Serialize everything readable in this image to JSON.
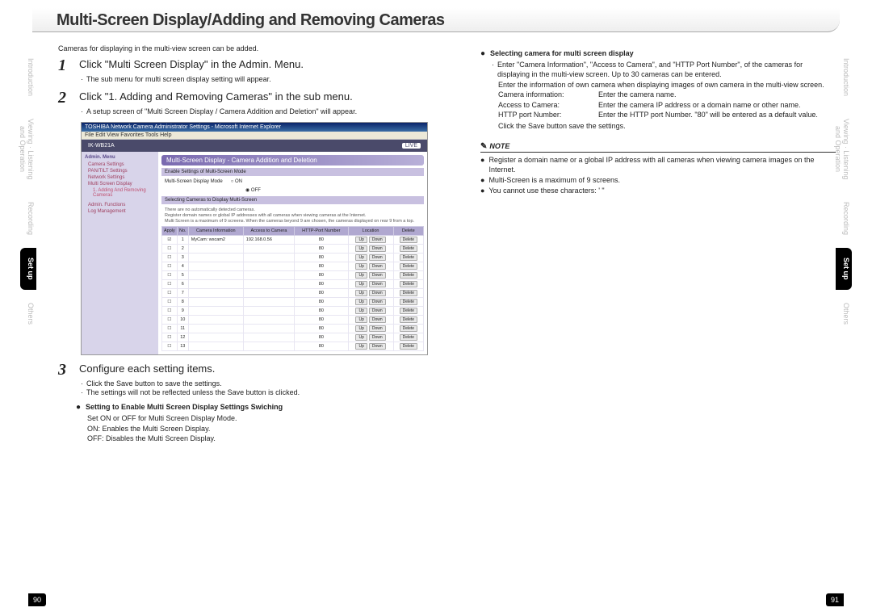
{
  "title": "Multi-Screen Display/Adding and Removing Cameras",
  "side_tabs": [
    "Introduction",
    "Viewing · Listening\nand Operation",
    "Recording",
    "Set up",
    "Others"
  ],
  "intro": "Cameras for displaying in the multi-view screen can be added.",
  "steps": {
    "s1": {
      "num": "1",
      "title": "Click \"Multi Screen Display\" in the Admin. Menu.",
      "b1": "The sub menu for multi screen display setting will appear."
    },
    "s2": {
      "num": "2",
      "title": "Click \"1. Adding and Removing Cameras\" in the sub menu.",
      "b1": "A setup screen of \"Multi Screen Display / Camera Addition and Deletion\" will appear."
    },
    "s3": {
      "num": "3",
      "title": "Configure each setting items.",
      "b1": "Click the Save button to save the settings.",
      "b2": "The settings will not be reflected unless the Save button is clicked."
    }
  },
  "screenshot": {
    "win_title": "TOSHIBA Network Camera Administrator Settings - Microsoft Internet Explorer",
    "menu": "File   Edit   View   Favorites   Tools   Help",
    "product": "IK-WB21A",
    "live": "LIVE",
    "admin_menu": "Admin. Menu",
    "nav": [
      "Camera Settings",
      "PAN/TILT Settings",
      "Network Settings",
      "Multi Screen Display"
    ],
    "nav_sub": [
      "1. Adding And Removing Cameras"
    ],
    "nav2": [
      "Admin. Functions",
      "Log Management"
    ],
    "panel_title": "Multi-Screen Display - Camera Addition and Deletion",
    "section1": "Enable Settings of Multi-Screen Mode",
    "mode_label": "Multi-Screen Display Mode",
    "on": "ON",
    "off": "OFF",
    "section2": "Selecting Cameras to Display Multi-Screen",
    "desc": "There are no automatically detected cameras.\nRegister domain names or global IP addresses with all cameras when viewing cameras at the Internet.\nMulti Screen is a maximum of 9 screens. When the cameras beyond 9 are chosen, the cameras displayed on rear 9 from a top.",
    "th": [
      "Apply",
      "No.",
      "Camera Information",
      "Access to Camera",
      "HTTP-Port Number",
      "Location",
      "Delete"
    ],
    "row1_info": "MyCam: wscam2",
    "row1_access": "192.168.0.56",
    "port_default": "80",
    "btn_up": "Up",
    "btn_down": "Down",
    "btn_delete": "Delete"
  },
  "col1_sub": {
    "heading": "Setting to Enable Multi Screen Display Settings Swiching",
    "l1": "Set ON or OFF for Multi Screen Display Mode.",
    "l2": "ON:  Enables the Multi Screen Display.",
    "l3": "OFF: Disables the Multi Screen Display."
  },
  "col2_sub": {
    "heading": "Selecting camera for multi screen display",
    "p1": "Enter \"Camera Information\", \"Access to Camera\", and \"HTTP Port Number\", of the cameras for displaying in the multi-view screen.  Up to 30 cameras can be entered.",
    "p2": "Enter the information of own camera when displaying images of own camera in the multi-view screen.",
    "d1_label": "Camera information:",
    "d1_val": "Enter the camera name.",
    "d2_label": "Access to Camera:",
    "d2_val": "Enter the camera IP address or a domain name or other name.",
    "d3_label": "HTTP port Number:",
    "d3_val": "Enter the HTTP port Number.  \"80\" will be entered as a default value.",
    "p3": "Click the Save button save the settings."
  },
  "note": {
    "label": "NOTE",
    "n1": "Register a domain name or a global IP address with all cameras when viewing camera images on the Internet.",
    "n2": "Multi-Screen is a maximum of 9 screens.",
    "n3": "You cannot use these characters: ' \""
  },
  "page_left": "90",
  "page_right": "91"
}
